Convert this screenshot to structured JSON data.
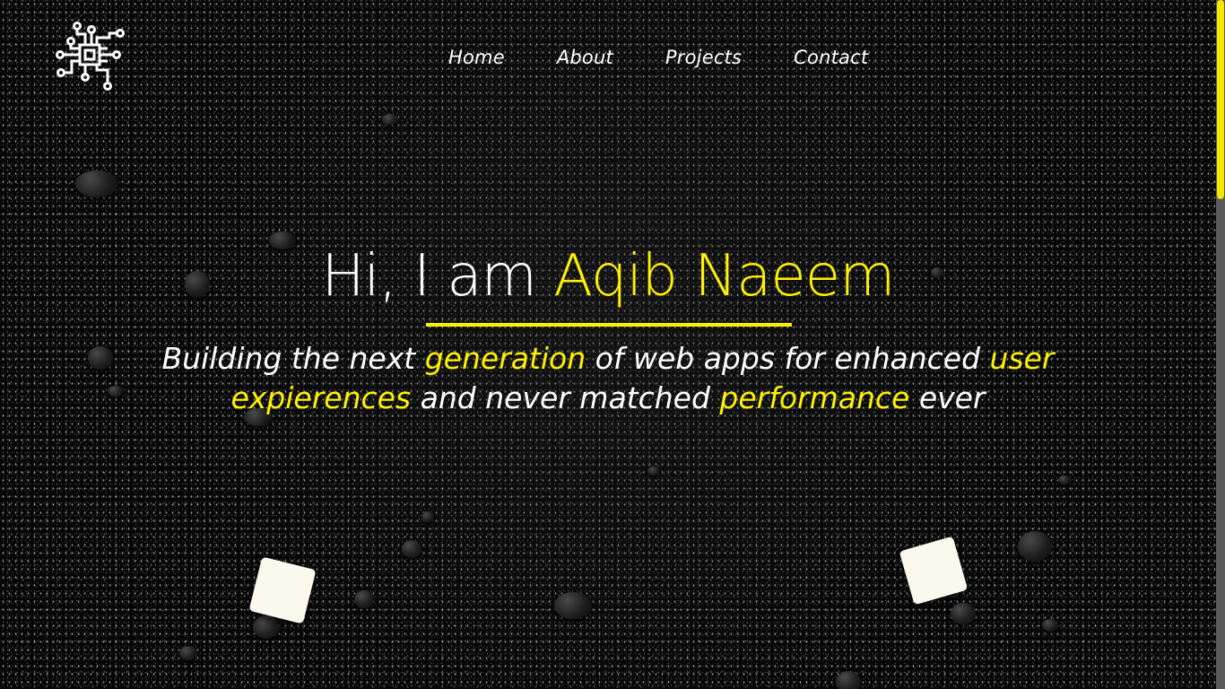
{
  "logo": {
    "icon": "circuit-chip-icon"
  },
  "nav": {
    "items": [
      {
        "label": "Home"
      },
      {
        "label": "About"
      },
      {
        "label": "Projects"
      },
      {
        "label": "Contact"
      }
    ]
  },
  "hero": {
    "greeting": "Hi, I am ",
    "name": "Aqib Naeem",
    "tagline": {
      "part1": "Building the next ",
      "highlight1": "generation",
      "part2": " of web apps for enhanced ",
      "highlight2": "user expierences",
      "part3": " and never matched ",
      "highlight3": "performance",
      "part4": " ever"
    }
  },
  "colors": {
    "accent": "#fff200",
    "background": "#070707",
    "text": "#ffffff",
    "card": "#fbf8ee"
  }
}
